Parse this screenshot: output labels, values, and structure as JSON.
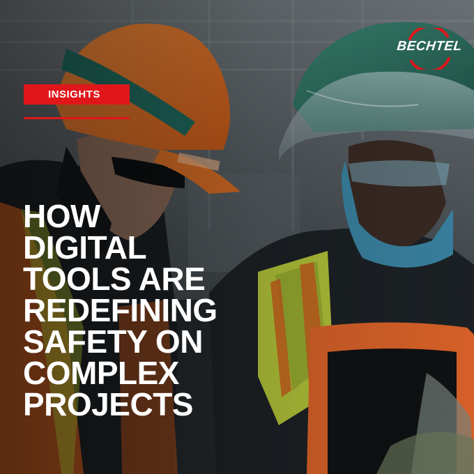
{
  "tag": {
    "label": "INSIGHTS"
  },
  "headline": {
    "lines": [
      "HOW",
      "DIGITAL",
      "TOOLS ARE",
      "REDEFINING",
      "SAFETY ON",
      "COMPLEX",
      "PROJECTS"
    ]
  },
  "logo": {
    "text": "BECHTEL"
  },
  "colors": {
    "accent": "#e0161b",
    "text": "#ffffff"
  }
}
